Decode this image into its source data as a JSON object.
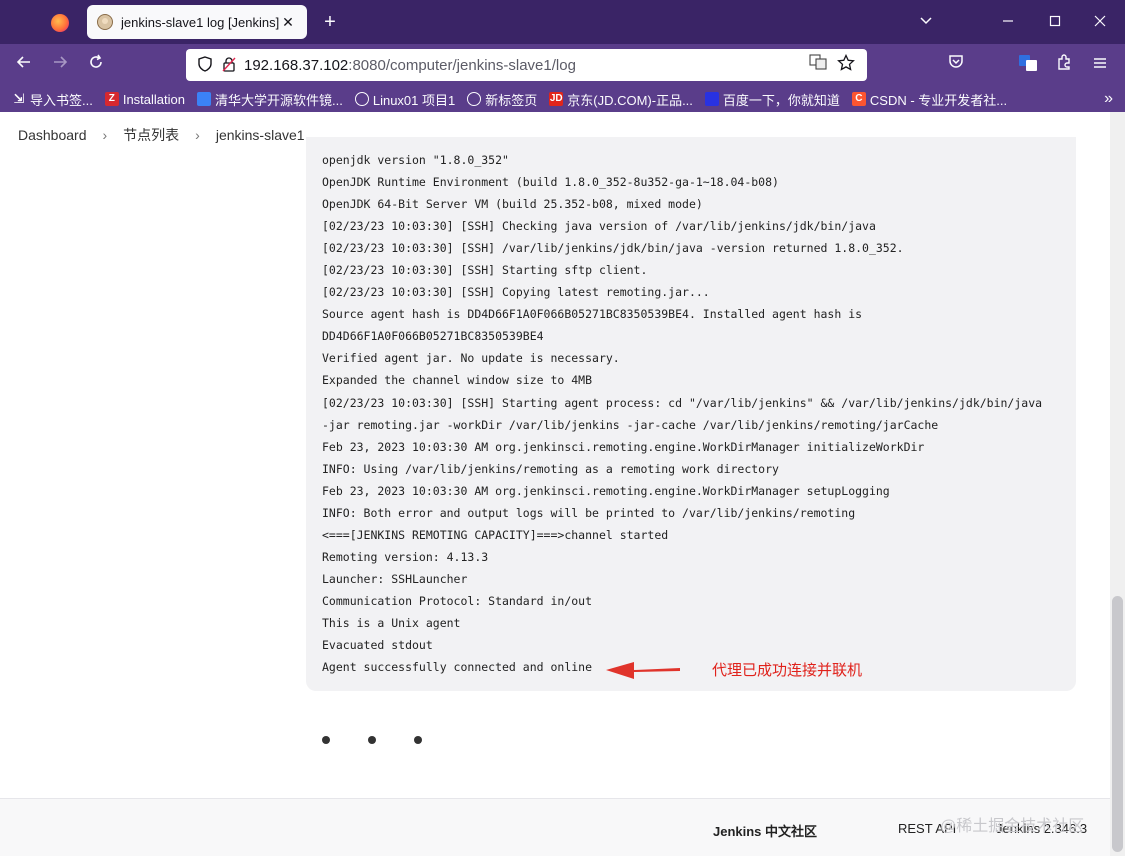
{
  "browser": {
    "tab_title": "jenkins-slave1 log [Jenkins]",
    "tab_close": "✕",
    "new_tab": "+",
    "url_host": "192.168.37.102",
    "url_rest": ":8080/computer/jenkins-slave1/log",
    "bookmarks": [
      {
        "label": "导入书签...",
        "icon": "import-icon",
        "color": "#5a3d8a"
      },
      {
        "label": "Installation",
        "icon": "Z",
        "color": "#d7282f"
      },
      {
        "label": "清华大学开源软件镜...",
        "icon": "tsinghua-icon",
        "color": "#3b82f6"
      },
      {
        "label": "Linux01 项目1",
        "icon": "globe-icon",
        "color": "#5a3d8a"
      },
      {
        "label": "新标签页",
        "icon": "globe-icon",
        "color": "#5a3d8a"
      },
      {
        "label": "京东(JD.COM)-正品...",
        "icon": "JD",
        "color": "#e1251b"
      },
      {
        "label": "百度一下，你就知道",
        "icon": "baidu-icon",
        "color": "#2932e1"
      },
      {
        "label": "CSDN - 专业开发者社...",
        "icon": "C",
        "color": "#fc5531"
      }
    ]
  },
  "breadcrumb": [
    "Dashboard",
    "节点列表",
    "jenkins-slave1"
  ],
  "log_lines": [
    "openjdk version \"1.8.0_352\"",
    "OpenJDK Runtime Environment (build 1.8.0_352-8u352-ga-1~18.04-b08)",
    "OpenJDK 64-Bit Server VM (build 25.352-b08, mixed mode)",
    "[02/23/23 10:03:30] [SSH] Checking java version of /var/lib/jenkins/jdk/bin/java",
    "[02/23/23 10:03:30] [SSH] /var/lib/jenkins/jdk/bin/java -version returned 1.8.0_352.",
    "[02/23/23 10:03:30] [SSH] Starting sftp client.",
    "[02/23/23 10:03:30] [SSH] Copying latest remoting.jar...",
    "Source agent hash is DD4D66F1A0F066B05271BC8350539BE4. Installed agent hash is",
    "DD4D66F1A0F066B05271BC8350539BE4",
    "Verified agent jar. No update is necessary.",
    "Expanded the channel window size to 4MB",
    "[02/23/23 10:03:30] [SSH] Starting agent process: cd \"/var/lib/jenkins\" && /var/lib/jenkins/jdk/bin/java",
    "-jar remoting.jar -workDir /var/lib/jenkins -jar-cache /var/lib/jenkins/remoting/jarCache",
    "Feb 23, 2023 10:03:30 AM org.jenkinsci.remoting.engine.WorkDirManager initializeWorkDir",
    "INFO: Using /var/lib/jenkins/remoting as a remoting work directory",
    "Feb 23, 2023 10:03:30 AM org.jenkinsci.remoting.engine.WorkDirManager setupLogging",
    "INFO: Both error and output logs will be printed to /var/lib/jenkins/remoting",
    "<===[JENKINS REMOTING CAPACITY]===>channel started",
    "Remoting version: 4.13.3",
    "Launcher: SSHLauncher",
    "Communication Protocol: Standard in/out",
    "This is a Unix agent",
    "Evacuated stdout",
    "Agent successfully connected and online"
  ],
  "annotation": {
    "text": "代理已成功连接并联机",
    "color": "#e0221b"
  },
  "footer": {
    "community": "Jenkins 中文社区",
    "rest_api": "REST API",
    "version": "Jenkins 2.346.3"
  },
  "watermark": "@稀土掘金技术社区"
}
